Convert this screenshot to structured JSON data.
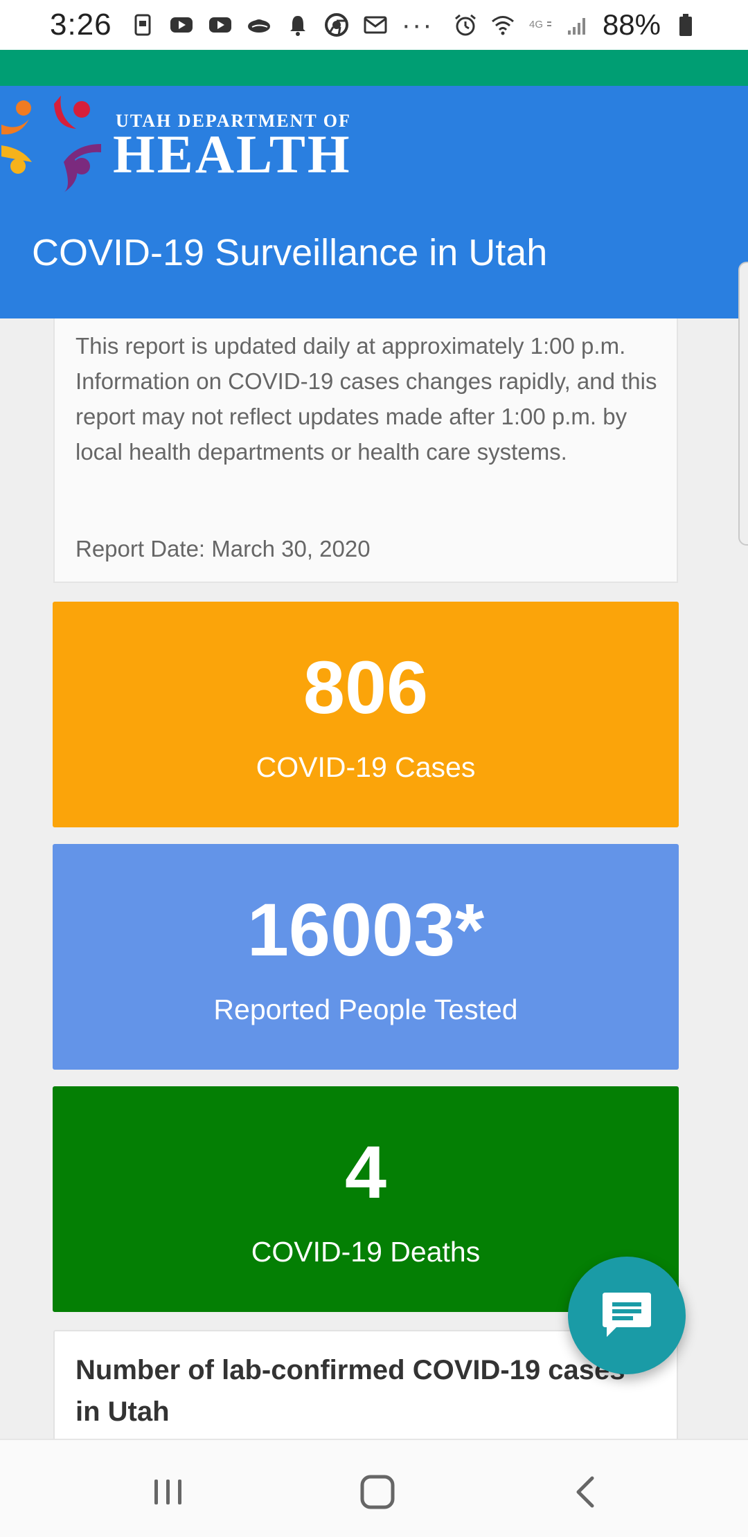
{
  "status_bar": {
    "time": "3:26",
    "overflow": "···",
    "battery_percent": "88%",
    "icons_left": [
      "id-card-icon",
      "youtube-icon",
      "youtube-icon",
      "cap-icon",
      "bell-icon",
      "chrome-icon",
      "mail-icon"
    ],
    "icons_right": [
      "alarm-icon",
      "wifi-icon",
      "lte-4g-icon",
      "signal-icon",
      "battery-icon"
    ]
  },
  "header": {
    "brand_small": "UTAH DEPARTMENT OF",
    "brand_big": "HEALTH",
    "title": "COVID-19 Surveillance in Utah"
  },
  "info": {
    "text": "This report is updated daily at approximately 1:00 p.m. Information on COVID-19 cases changes rapidly, and this report may not reflect updates made after 1:00 p.m. by local health departments or health care systems.",
    "report_date": "Report Date: March 30, 2020"
  },
  "stats": {
    "cases": {
      "value": "806",
      "label": "COVID-19 Cases",
      "color": "#fba40a"
    },
    "tested": {
      "value": "16003*",
      "label": "Reported People Tested",
      "color": "#6394e8"
    },
    "deaths": {
      "value": "4",
      "label": "COVID-19 Deaths",
      "color": "#047f04"
    }
  },
  "next_section": {
    "title": "Number of lab-confirmed COVID-19 cases in Utah"
  },
  "colors": {
    "header_blue": "#2a7fe0",
    "top_band_green": "#009e73",
    "chat_fab": "#1a9ba6"
  },
  "nav": [
    "recents-icon",
    "home-icon",
    "back-icon"
  ]
}
